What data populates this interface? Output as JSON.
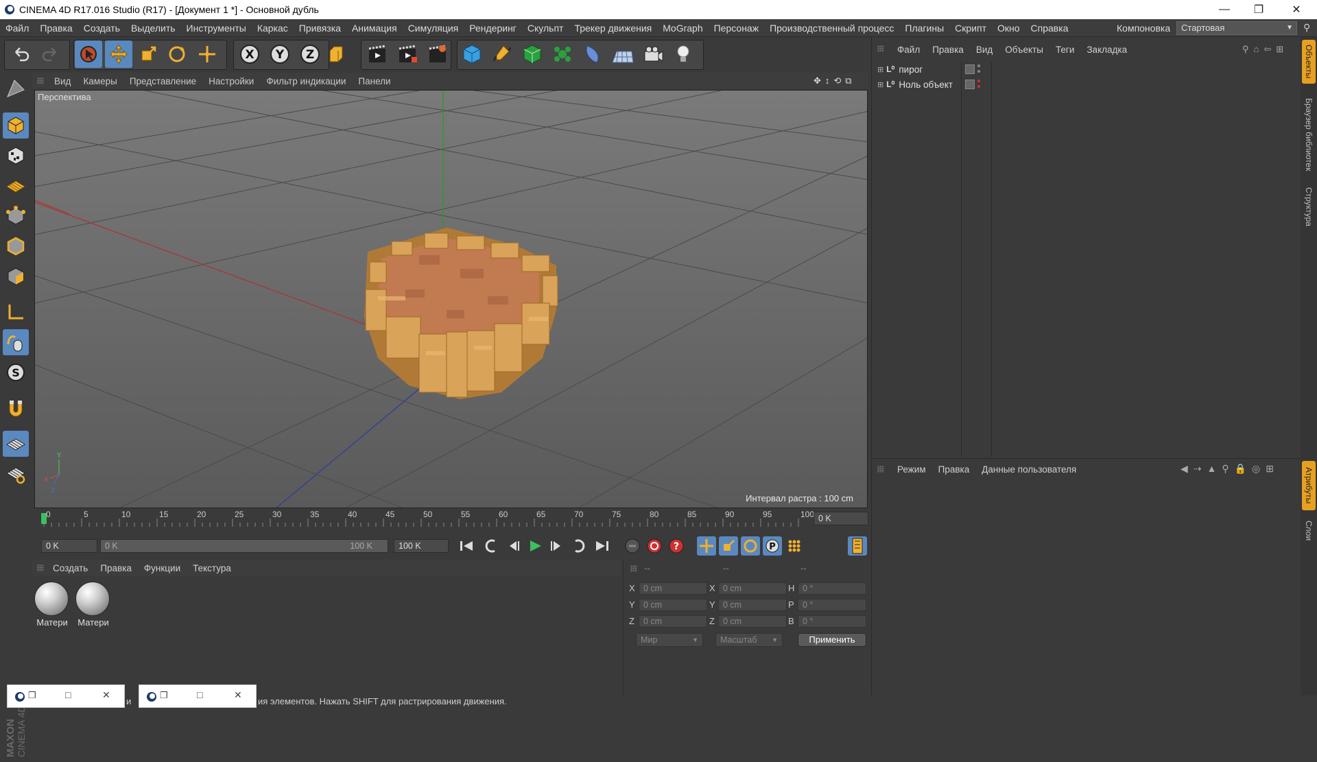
{
  "window": {
    "title": "CINEMA 4D R17.016 Studio (R17) - [Документ 1 *] - Основной дубль",
    "minimize": "—",
    "restore": "❐",
    "close": "✕"
  },
  "menubar": {
    "items": [
      "Файл",
      "Правка",
      "Создать",
      "Выделить",
      "Инструменты",
      "Каркас",
      "Привязка",
      "Анимация",
      "Симуляция",
      "Рендеринг",
      "Скульпт",
      "Трекер движения",
      "MoGraph",
      "Персонаж",
      "Производственный процесс",
      "Плагины",
      "Скрипт",
      "Окно",
      "Справка"
    ],
    "layout_label": "Компоновка",
    "layout_value": "Стартовая"
  },
  "viewport": {
    "menu": [
      "Вид",
      "Камеры",
      "Представление",
      "Настройки",
      "Фильтр индикации",
      "Панели"
    ],
    "label": "Перспектива",
    "grid_interval": "Интервал растра : 100 cm"
  },
  "timeline": {
    "ticks": [
      "0",
      "5",
      "10",
      "15",
      "20",
      "25",
      "30",
      "35",
      "40",
      "45",
      "50",
      "55",
      "60",
      "65",
      "70",
      "75",
      "80",
      "85",
      "90",
      "95",
      "100"
    ],
    "current_frame": "0 K",
    "start_field": "0 K",
    "range_start": "0 K",
    "range_end": "100 K",
    "end_field": "100 K"
  },
  "materials": {
    "menu": [
      "Создать",
      "Правка",
      "Функции",
      "Текстура"
    ],
    "items": [
      "Матери",
      "Матери"
    ],
    "brand_line1": "MAXON",
    "brand_line2": "CINEMA 4D"
  },
  "coords": {
    "headers": [
      "--",
      "--",
      "--"
    ],
    "rows": [
      {
        "a": "X",
        "av": "0 cm",
        "b": "X",
        "bv": "0 cm",
        "c": "H",
        "cv": "0 °"
      },
      {
        "a": "Y",
        "av": "0 cm",
        "b": "Y",
        "bv": "0 cm",
        "c": "P",
        "cv": "0 °"
      },
      {
        "a": "Z",
        "av": "0 cm",
        "b": "Z",
        "bv": "0 cm",
        "c": "B",
        "cv": "0 °"
      }
    ],
    "mode1": "Мир",
    "mode2": "Масштаб",
    "apply": "Применить"
  },
  "objects": {
    "menu": [
      "Файл",
      "Правка",
      "Вид",
      "Объекты",
      "Теги",
      "Закладка"
    ],
    "items": [
      "пирог",
      "Ноль объект"
    ]
  },
  "attributes": {
    "menu": [
      "Режим",
      "Правка",
      "Данные пользователя"
    ]
  },
  "right_tabs": [
    "Объекты",
    "Браузер библиотек",
    "Структура",
    "Атрибуты",
    "Слои"
  ],
  "status": {
    "text": "ия элементов. Нажать SHIFT для растрирования движения.",
    "frag": "и"
  },
  "colors": {
    "highlight": "#5a89bf",
    "tab_active": "#e8a020",
    "pie_crust": "#d9a35a",
    "pie_filling": "#c27a50"
  }
}
